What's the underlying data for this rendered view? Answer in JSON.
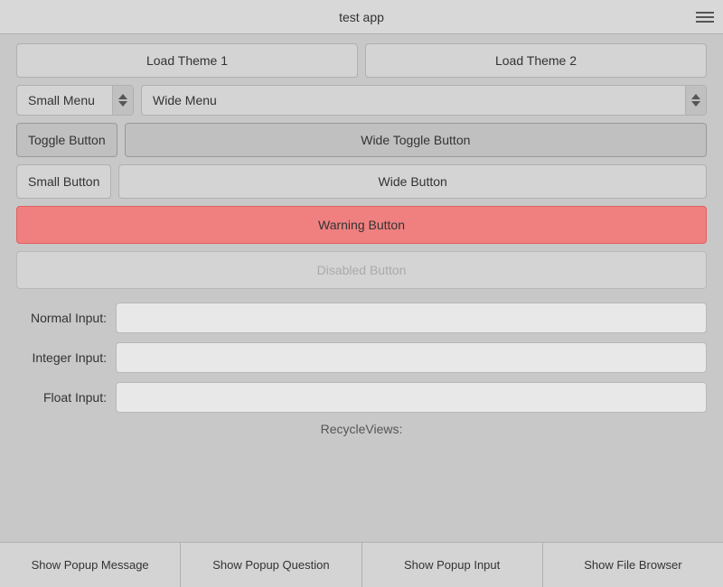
{
  "titleBar": {
    "title": "test app",
    "menuIcon": "hamburger-menu"
  },
  "buttons": {
    "loadTheme1": "Load Theme 1",
    "loadTheme2": "Load Theme 2",
    "smallMenu": "Small Menu",
    "wideMenu": "Wide Menu",
    "toggleButton": "Toggle Button",
    "wideToggleButton": "Wide Toggle Button",
    "smallButton": "Small Button",
    "wideButton": "Wide Button",
    "warningButton": "Warning Button",
    "disabledButton": "Disabled Button"
  },
  "inputs": {
    "normalLabel": "Normal Input:",
    "integerLabel": "Integer Input:",
    "floatLabel": "Float Input:",
    "normalValue": "",
    "integerValue": "",
    "floatValue": ""
  },
  "sections": {
    "recycleViewsLabel": "RecycleViews:"
  },
  "bottomBar": {
    "showPopupMessage": "Show Popup Message",
    "showPopupQuestion": "Show Popup Question",
    "showPopupInput": "Show Popup Input",
    "showFileBrowser": "Show File Browser"
  }
}
